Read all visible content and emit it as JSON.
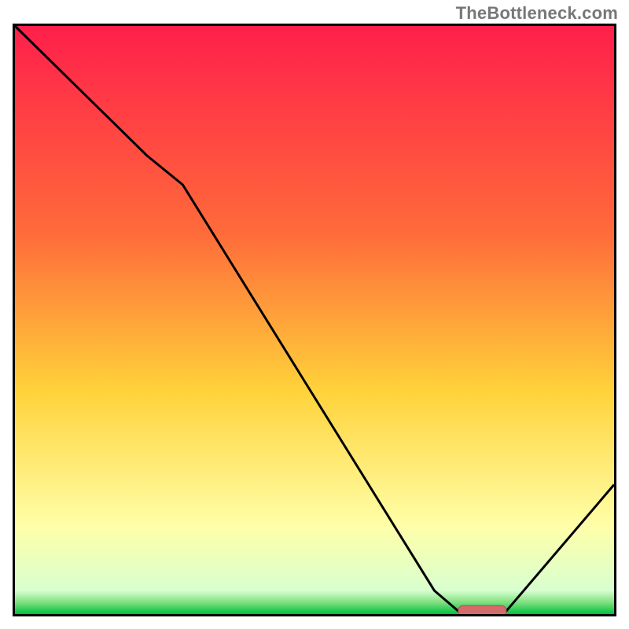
{
  "watermark": "TheBottleneck.com",
  "colors": {
    "frame": "#000000",
    "curve": "#000000",
    "marker_fill": "#d46a6a",
    "marker_stroke": "#b24d4d",
    "grad_top": "#ff1f4b",
    "grad_mid1": "#ff6a3a",
    "grad_mid2": "#ffd23a",
    "grad_lightband": "#ffffa8",
    "grad_green1": "#80e080",
    "grad_green2": "#00c040"
  },
  "chart_data": {
    "type": "line",
    "title": "",
    "xlabel": "",
    "ylabel": "",
    "xlim": [
      0,
      100
    ],
    "ylim": [
      0,
      100
    ],
    "curve": [
      {
        "x": 0,
        "y": 100
      },
      {
        "x": 22,
        "y": 78
      },
      {
        "x": 28,
        "y": 73
      },
      {
        "x": 70,
        "y": 4
      },
      {
        "x": 74,
        "y": 0.5
      },
      {
        "x": 82,
        "y": 0.5
      },
      {
        "x": 100,
        "y": 22
      }
    ],
    "marker": {
      "x_start": 74,
      "x_end": 82,
      "y": 0.5
    },
    "gradient_bands": [
      {
        "pos": 0.0,
        "color": "red-pink"
      },
      {
        "pos": 0.35,
        "color": "orange"
      },
      {
        "pos": 0.62,
        "color": "yellow"
      },
      {
        "pos": 0.85,
        "color": "pale-yellow"
      },
      {
        "pos": 0.97,
        "color": "light-green"
      },
      {
        "pos": 1.0,
        "color": "green"
      }
    ]
  }
}
